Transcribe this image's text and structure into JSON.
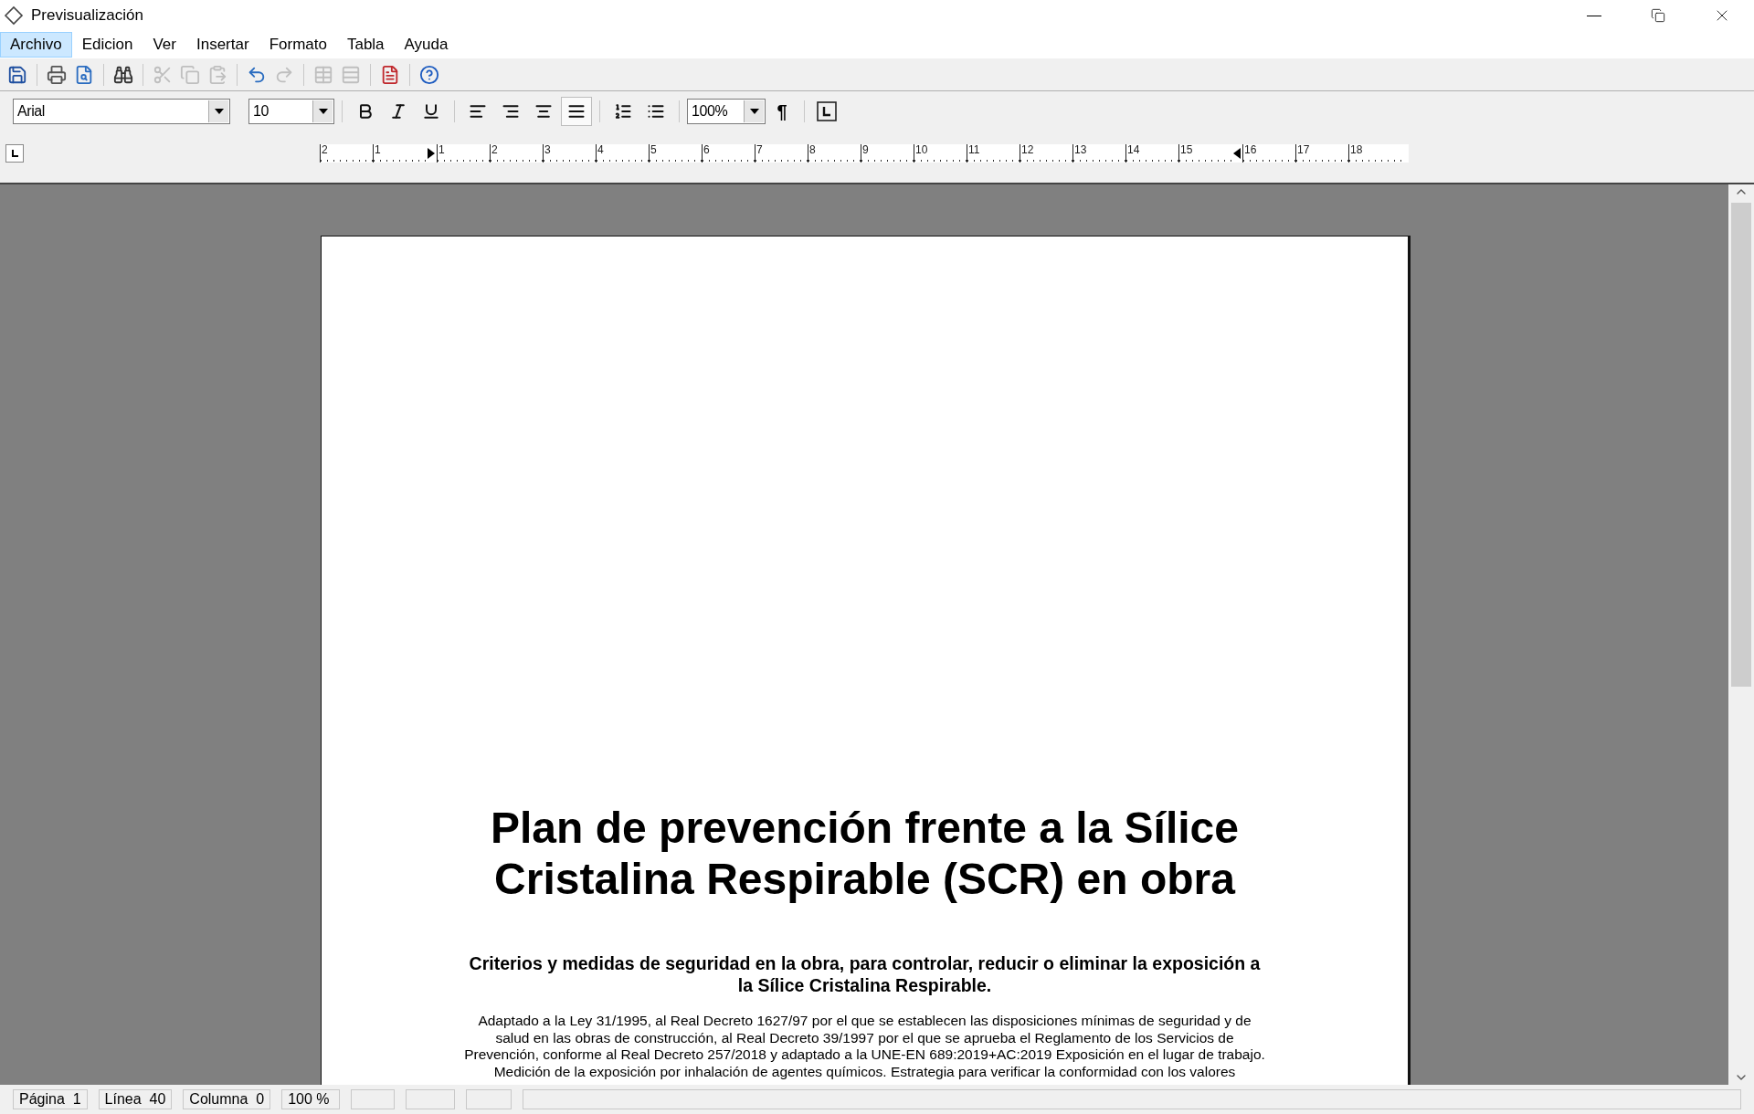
{
  "window": {
    "title": "Previsualización"
  },
  "menu": [
    {
      "label": "Archivo",
      "selected": true
    },
    {
      "label": "Edicion",
      "selected": false
    },
    {
      "label": "Ver",
      "selected": false
    },
    {
      "label": "Insertar",
      "selected": false
    },
    {
      "label": "Formato",
      "selected": false
    },
    {
      "label": "Tabla",
      "selected": false
    },
    {
      "label": "Ayuda",
      "selected": false
    }
  ],
  "toolbar": [
    {
      "kind": "save",
      "disabled": false
    },
    {
      "kind": "sep"
    },
    {
      "kind": "print",
      "disabled": false
    },
    {
      "kind": "preview",
      "disabled": false
    },
    {
      "kind": "sep"
    },
    {
      "kind": "find",
      "disabled": false
    },
    {
      "kind": "sep"
    },
    {
      "kind": "cut",
      "disabled": true
    },
    {
      "kind": "copy",
      "disabled": true
    },
    {
      "kind": "paste",
      "disabled": true
    },
    {
      "kind": "sep"
    },
    {
      "kind": "undo",
      "disabled": false
    },
    {
      "kind": "redo",
      "disabled": true
    },
    {
      "kind": "sep"
    },
    {
      "kind": "table",
      "disabled": true
    },
    {
      "kind": "table-rows",
      "disabled": true
    },
    {
      "kind": "sep"
    },
    {
      "kind": "pdf",
      "disabled": false
    },
    {
      "kind": "sep"
    },
    {
      "kind": "help",
      "disabled": false
    }
  ],
  "format_bar": {
    "font": "Arial",
    "size": "10",
    "zoom": "100%",
    "pilcrow": "¶",
    "buttons": [
      {
        "kind": "bold",
        "selected": false
      },
      {
        "kind": "italic",
        "selected": false
      },
      {
        "kind": "underline",
        "selected": false
      },
      {
        "kind": "sep"
      },
      {
        "kind": "align-left",
        "selected": false
      },
      {
        "kind": "align-right",
        "selected": false
      },
      {
        "kind": "align-center",
        "selected": false
      },
      {
        "kind": "align-justify",
        "selected": true
      },
      {
        "kind": "sep"
      },
      {
        "kind": "list-ordered",
        "selected": false
      },
      {
        "kind": "list-bullet",
        "selected": false
      }
    ]
  },
  "ruler": {
    "marks": [
      {
        "kind": "number",
        "label": "2"
      },
      {
        "kind": "number",
        "label": "1"
      },
      {
        "kind": "indent"
      },
      {
        "kind": "number",
        "label": "1"
      },
      {
        "kind": "number",
        "label": "2"
      },
      {
        "kind": "number",
        "label": "3"
      },
      {
        "kind": "number",
        "label": "4"
      },
      {
        "kind": "number",
        "label": "5"
      },
      {
        "kind": "number",
        "label": "6"
      },
      {
        "kind": "number",
        "label": "7"
      },
      {
        "kind": "number",
        "label": "8"
      },
      {
        "kind": "number",
        "label": "9"
      },
      {
        "kind": "number",
        "label": "10"
      },
      {
        "kind": "number",
        "label": "11"
      },
      {
        "kind": "number",
        "label": "12"
      },
      {
        "kind": "number",
        "label": "13"
      },
      {
        "kind": "number",
        "label": "14"
      },
      {
        "kind": "number",
        "label": "15"
      },
      {
        "kind": "right-indent"
      },
      {
        "kind": "number",
        "label": "16"
      },
      {
        "kind": "number",
        "label": "17"
      },
      {
        "kind": "number",
        "label": "18"
      }
    ]
  },
  "document": {
    "title": "Plan de prevención frente a la Sílice Cristalina Respirable (SCR) en obra",
    "subtitle": "Criterios y medidas de seguridad en la obra, para controlar, reducir o eliminar la exposición a la Sílice Cristalina Respirable.",
    "paragraph": "Adaptado a la Ley 31/1995, al Real Decreto 1627/97 por el que se establecen las disposiciones mínimas de seguridad y de salud en las obras de construcción, al Real Decreto 39/1997 por el que se aprueba el Reglamento de los Servicios de Prevención, conforme al Real Decreto 257/2018 y adaptado a la UNE-EN 689:2019+AC:2019 Exposición en el lugar de trabajo. Medición de la exposición por inhalación de agentes químicos. Estrategia para verificar la conformidad con los valores"
  },
  "status_bar": [
    "Página  1",
    "Línea  40",
    "Columna  0",
    "100 %"
  ]
}
